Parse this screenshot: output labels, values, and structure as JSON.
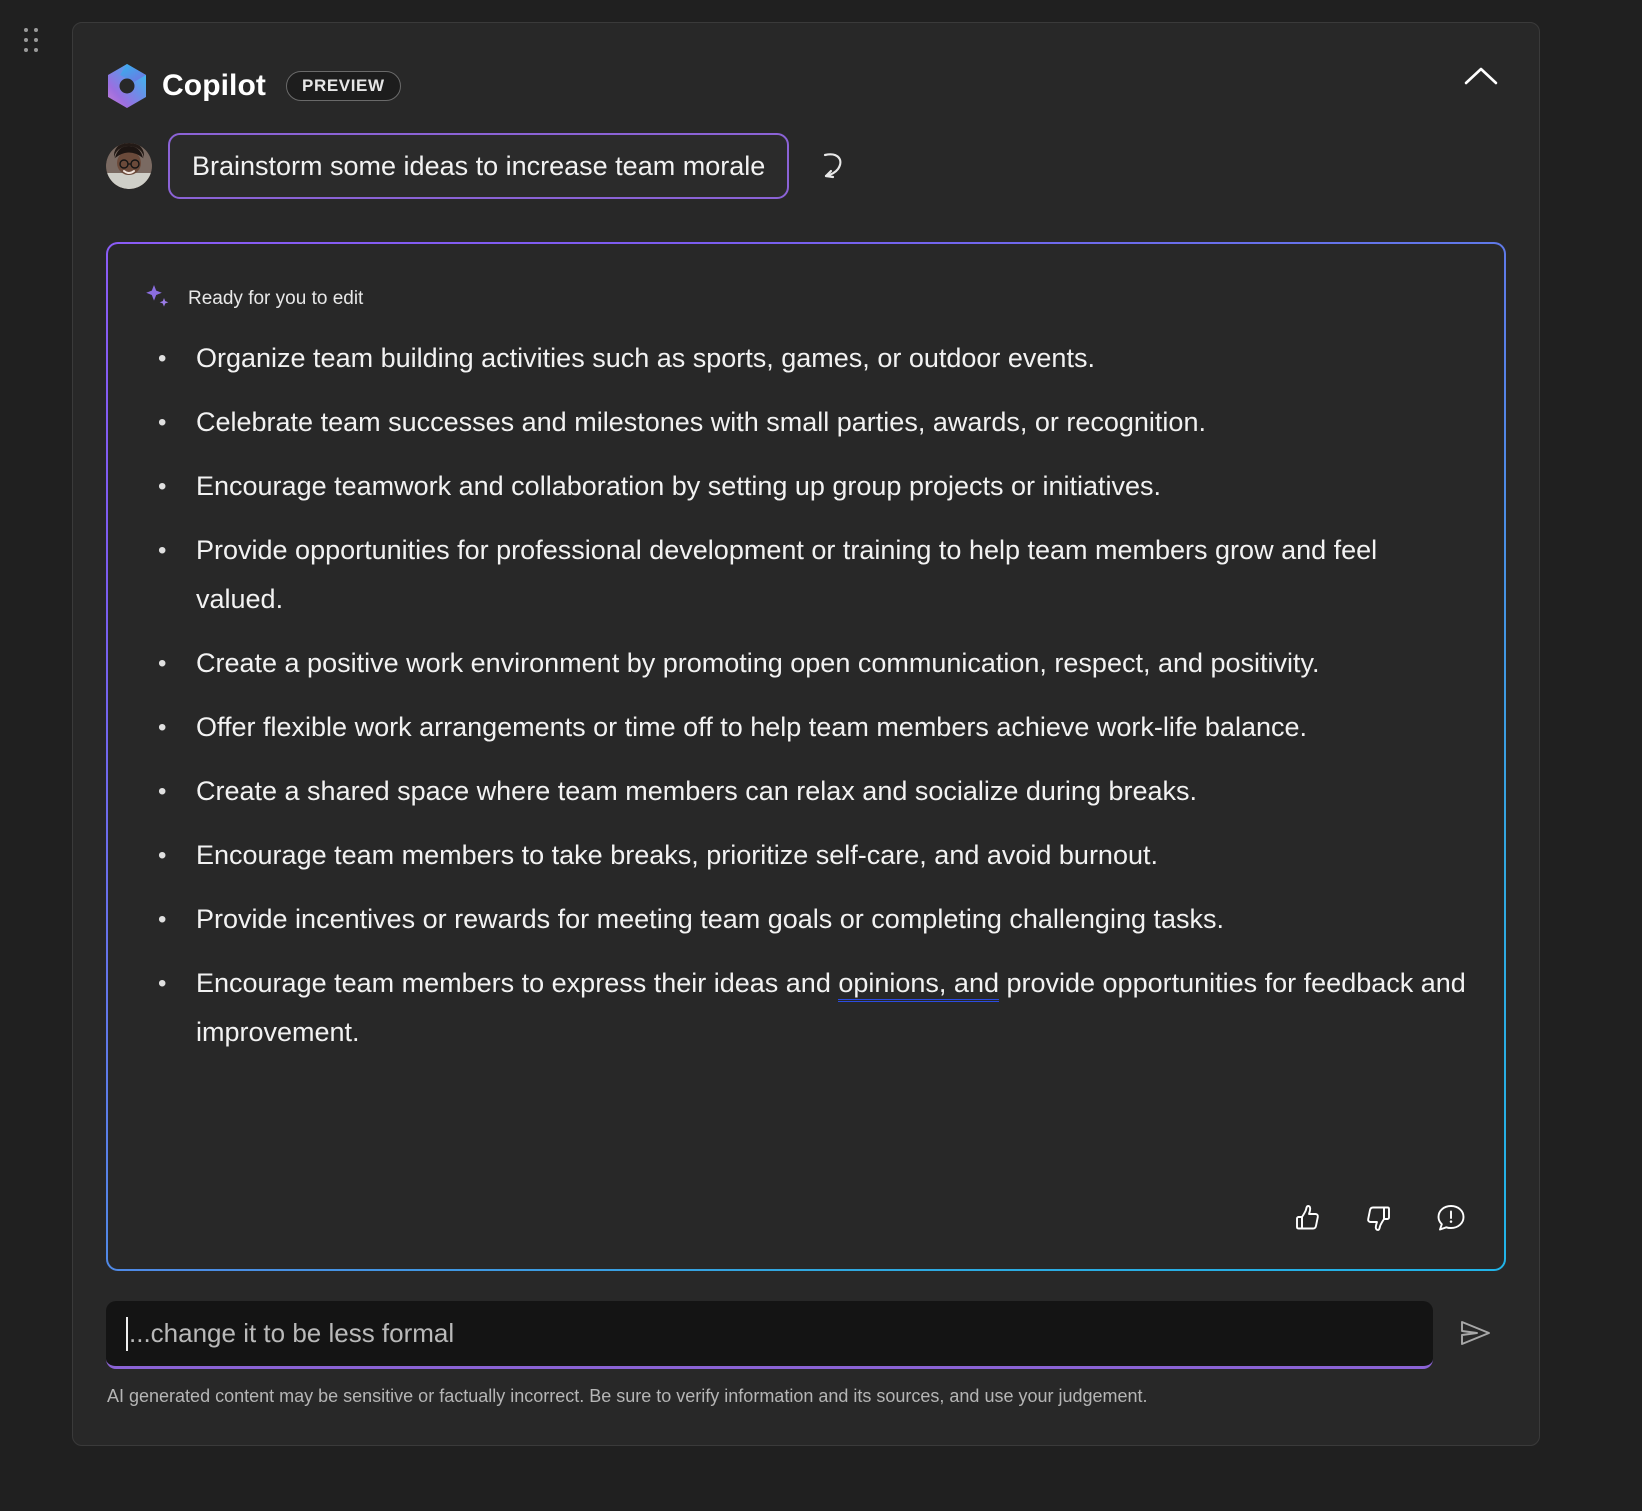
{
  "window": {
    "background_color": "#202020",
    "panel_color": "#282828"
  },
  "handle": {
    "name": "drag-handle"
  },
  "header": {
    "title": "Copilot",
    "badge": "PREVIEW",
    "logo_icon": "copilot-logo-icon",
    "collapse_icon": "chevron-up-icon",
    "accent_purple": "#8b63d6",
    "accent_cyan": "#21b4e8"
  },
  "prompt": {
    "avatar_icon": "user-avatar",
    "text": "Brainstorm some ideas to increase team morale",
    "redo_icon": "undo-arrow-icon"
  },
  "response": {
    "status_icon": "sparkle-icon",
    "status_label": "Ready for you to edit",
    "ideas": [
      "Organize team building activities such as sports, games, or outdoor events.",
      "Celebrate team successes and milestones with small parties, awards, or recognition.",
      "Encourage teamwork and collaboration by setting up group projects or initiatives.",
      "Provide opportunities for professional development or training to help team members grow and feel valued.",
      "Create a positive work environment by promoting open communication, respect, and positivity.",
      "Offer flexible work arrangements or time off to help team members achieve work-life balance.",
      "Create a shared space where team members can relax and socialize during breaks.",
      "Encourage team members to take breaks, prioritize self-care, and avoid burnout.",
      "Provide incentives or rewards for meeting team goals or completing challenging tasks."
    ],
    "last_idea": {
      "before": "Encourage team members to express their ideas and ",
      "suggestion": "opinions, and",
      "after": " provide opportunities for feedback and improvement.",
      "suggestion_underline_color": "#2b4be0"
    },
    "feedback": {
      "like_icon": "thumbs-up-icon",
      "dislike_icon": "thumbs-down-icon",
      "report_icon": "report-feedback-icon"
    }
  },
  "compose": {
    "placeholder": "...change it to be less formal",
    "value": "",
    "send_icon": "send-icon"
  },
  "footer": {
    "disclaimer": "AI generated content may be sensitive or factually incorrect. Be sure to verify information and its sources, and use your judgement."
  }
}
